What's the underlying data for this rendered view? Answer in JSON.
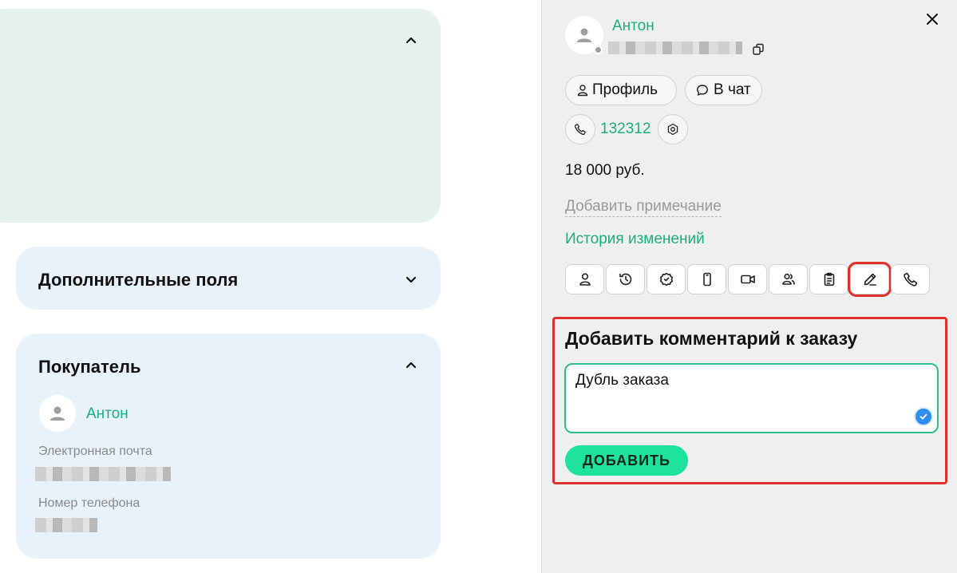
{
  "left": {
    "additional_fields": {
      "title": "Дополнительные поля"
    },
    "buyer": {
      "title": "Покупатель",
      "name": "Антон",
      "email_label": "Электронная почта",
      "phone_label": "Номер телефона"
    }
  },
  "panel": {
    "user_name": "Антон",
    "buttons": {
      "profile": "Профиль",
      "chat": "В чат"
    },
    "phone_number": "132312",
    "amount": "18 000 руб.",
    "add_note": "Добавить примечание",
    "history": "История изменений",
    "toolbar_icons": [
      "user-icon",
      "history-icon",
      "badge-icon",
      "mobile-icon",
      "video-icon",
      "users-icon",
      "clipboard-icon",
      "pencil-icon",
      "phone-icon"
    ],
    "comment": {
      "title": "Добавить комментарий к заказу",
      "value": "Дубль заказа",
      "submit": "ДОБАВИТЬ"
    }
  },
  "colors": {
    "accent_green": "#1bb07a",
    "button_green": "#1ee39a",
    "highlight_red": "#e0302c"
  }
}
